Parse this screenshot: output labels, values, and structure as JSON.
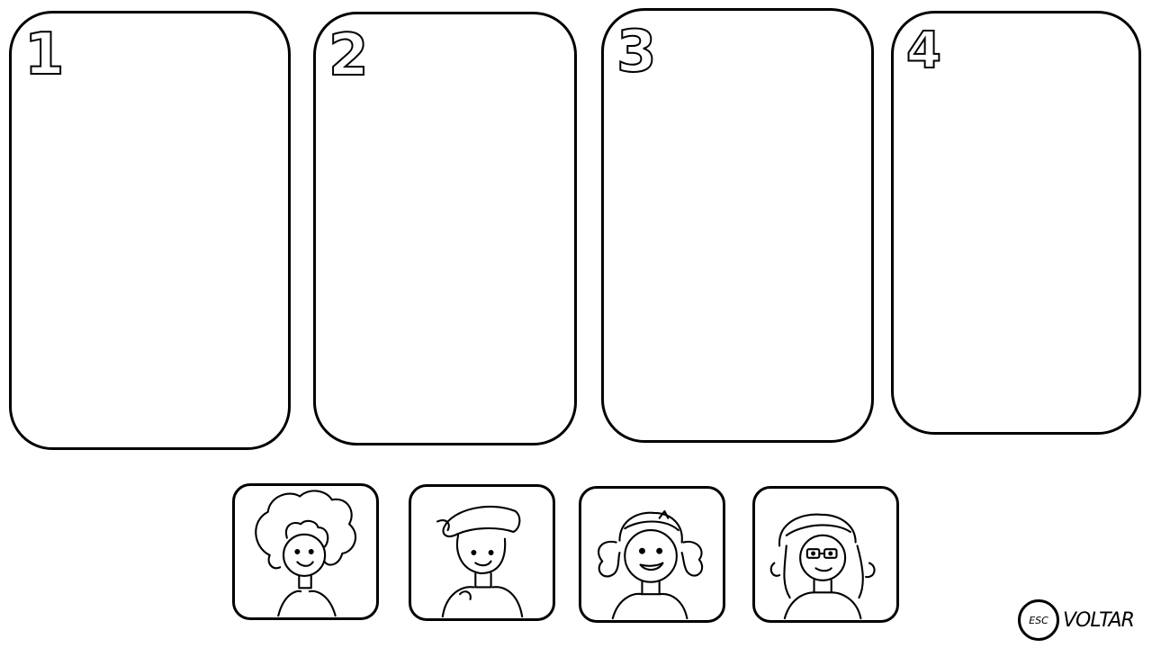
{
  "slots": [
    {
      "number": "1"
    },
    {
      "number": "2"
    },
    {
      "number": "3"
    },
    {
      "number": "4"
    }
  ],
  "characters": [
    {
      "icon": "curly-hair-character-portrait"
    },
    {
      "icon": "cap-character-portrait"
    },
    {
      "icon": "pigtails-character-portrait"
    },
    {
      "icon": "glasses-character-portrait"
    }
  ],
  "back": {
    "key": "ESC",
    "label": "VOLTAR"
  }
}
